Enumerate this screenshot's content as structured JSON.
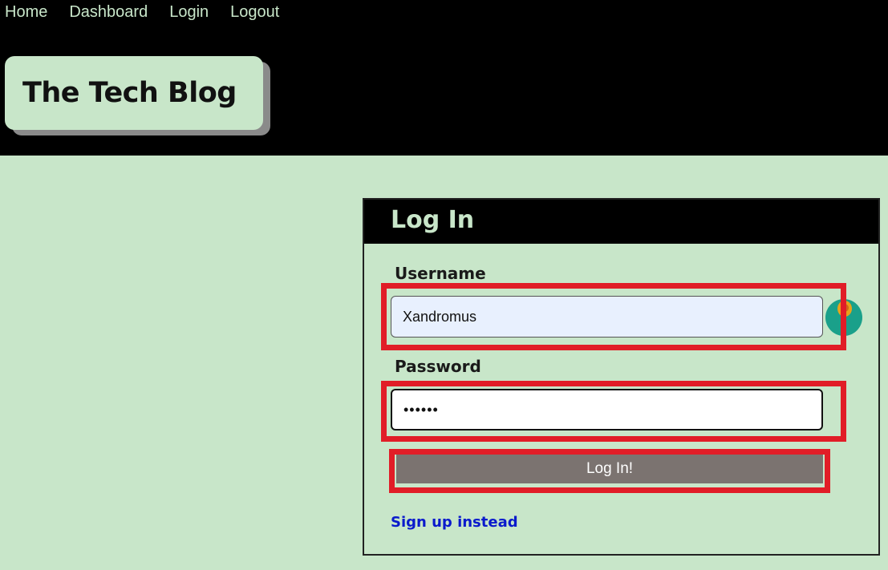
{
  "nav": {
    "items": [
      {
        "label": "Home"
      },
      {
        "label": "Dashboard"
      },
      {
        "label": "Login"
      },
      {
        "label": "Logout"
      }
    ]
  },
  "site": {
    "title": "The Tech Blog"
  },
  "login_form": {
    "heading": "Log In",
    "username_label": "Username",
    "username_value": "Xandromus",
    "password_label": "Password",
    "password_value": "••••••",
    "submit_label": "Log In!",
    "signup_link": "Sign up instead"
  },
  "colors": {
    "page_background": "#c8e6c9",
    "header_background": "#000000",
    "button_background": "#7b7370",
    "link_color": "#0a1acc",
    "highlight_color": "#e11d27"
  },
  "icons": {
    "password_manager": "password-manager-icon"
  }
}
